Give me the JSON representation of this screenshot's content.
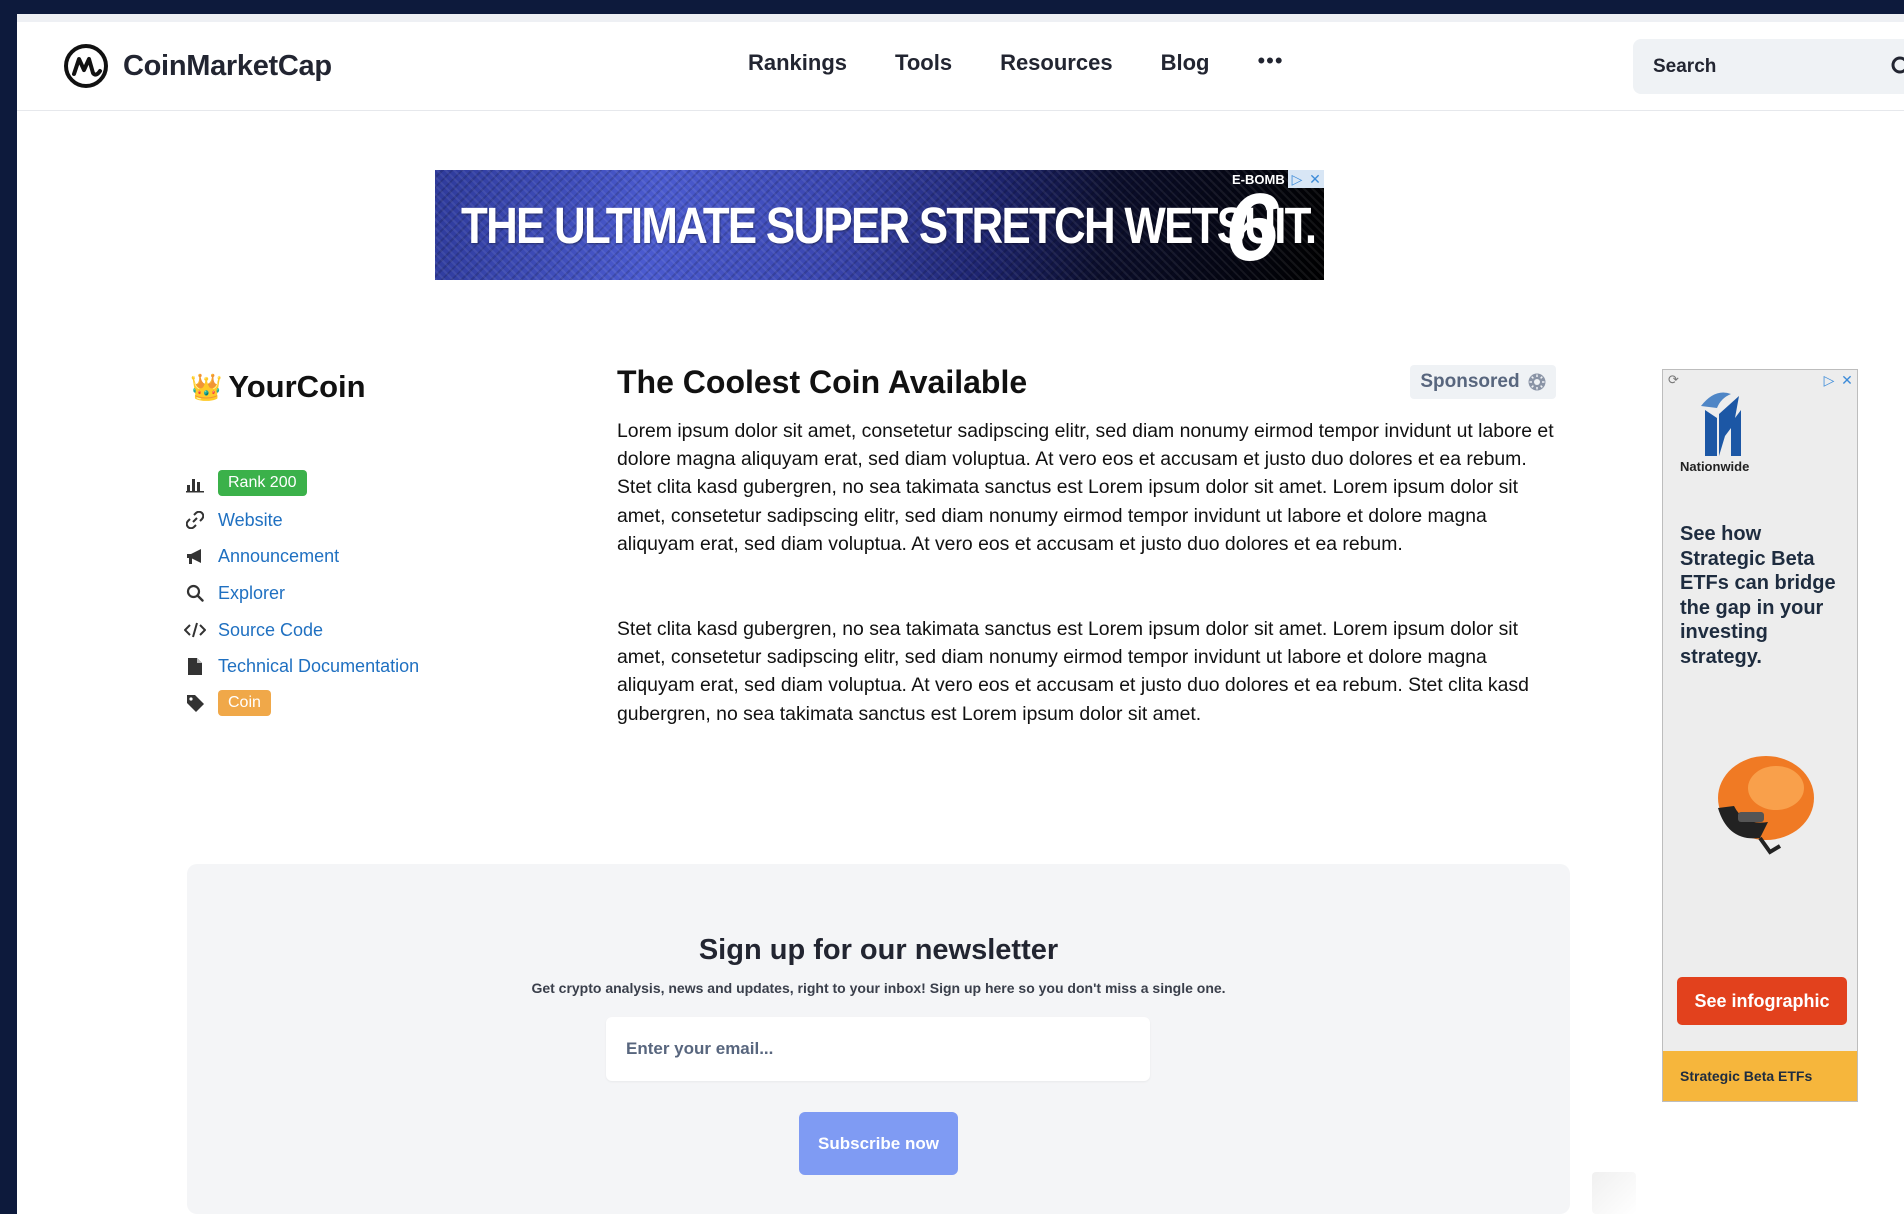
{
  "header": {
    "logo_text": "CoinMarketCap",
    "nav": [
      "Rankings",
      "Tools",
      "Resources",
      "Blog"
    ],
    "more_label": "•••",
    "search_placeholder": "Search"
  },
  "banner_ad": {
    "headline": "THE ULTIMATE SUPER STRETCH WETSUIT.",
    "brand": "E-BOMB",
    "brand_mark": "6"
  },
  "coin": {
    "crown": "👑",
    "name": "YourCoin",
    "rank_badge": "Rank 200",
    "rank_color": "#3bb14a",
    "links": [
      "Website",
      "Announcement",
      "Explorer",
      "Source Code",
      "Technical Documentation"
    ],
    "tag_badge": "Coin",
    "tag_color": "#f0a849"
  },
  "article": {
    "title": "The Coolest Coin Available",
    "sponsored_label": "Sponsored",
    "paragraphs": [
      "Lorem ipsum dolor sit amet, consetetur sadipscing elitr, sed diam nonumy eirmod tempor invidunt ut labore et dolore magna aliquyam erat, sed diam voluptua. At vero eos et accusam et justo duo dolores et ea rebum. Stet clita kasd gubergren, no sea takimata sanctus est Lorem ipsum dolor sit amet. Lorem ipsum dolor sit amet, consetetur sadipscing elitr, sed diam nonumy eirmod tempor invidunt ut labore et dolore magna aliquyam erat, sed diam voluptua. At vero eos et accusam et justo duo dolores et ea rebum.",
      "Stet clita kasd gubergren, no sea takimata sanctus est Lorem ipsum dolor sit amet. Lorem ipsum dolor sit amet, consetetur sadipscing elitr, sed diam nonumy eirmod tempor invidunt ut labore et dolore magna aliquyam erat, sed diam voluptua. At vero eos et accusam et justo duo dolores et ea rebum. Stet clita kasd gubergren, no sea takimata sanctus est Lorem ipsum dolor sit amet."
    ]
  },
  "side_ad": {
    "brand": "Nationwide",
    "copy": "See how Strategic Beta ETFs can bridge the gap in your investing strategy.",
    "cta": "See infographic",
    "footer": "Strategic Beta ETFs",
    "cta_color": "#e2411d",
    "footer_color": "#f6b63c"
  },
  "newsletter": {
    "title": "Sign up for our newsletter",
    "subtitle": "Get crypto analysis, news and updates, right to your inbox! Sign up here so you don't miss a single one.",
    "email_placeholder": "Enter your email...",
    "button_label": "Subscribe now"
  }
}
